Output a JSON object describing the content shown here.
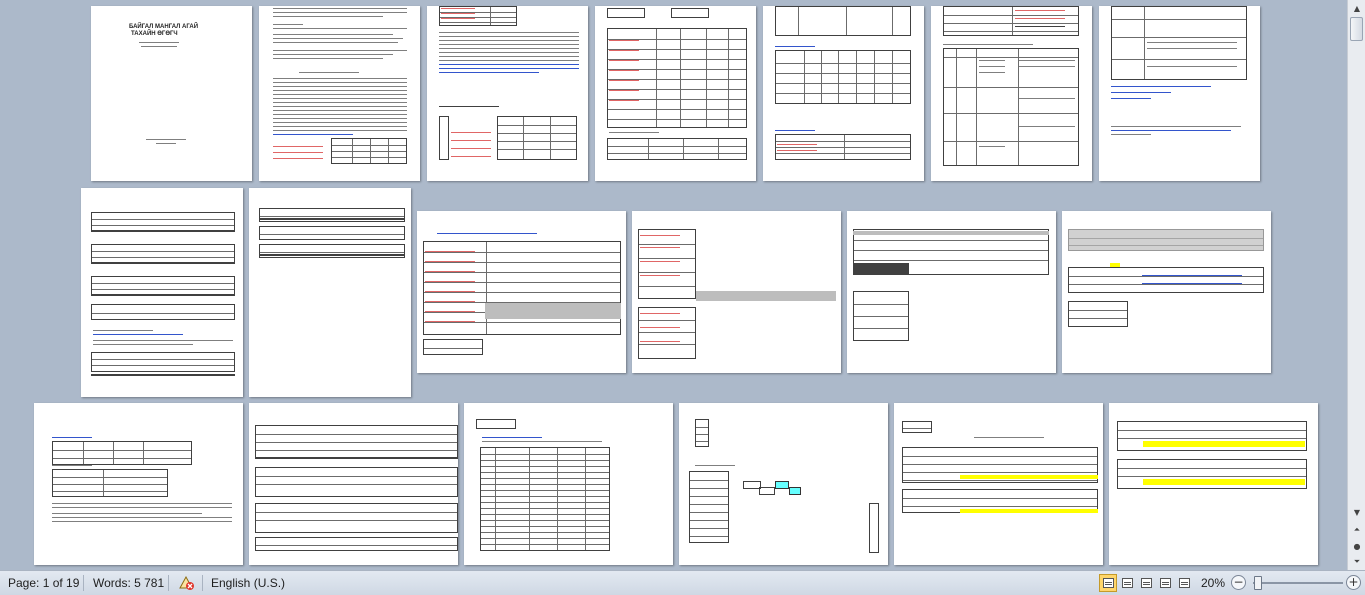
{
  "document": {
    "cover_title_line1": "БАЙГАЛ МАНГАЛ АГАЙ",
    "cover_title_line2": "ТАХАЙН ӨГӨГЧ"
  },
  "statusbar": {
    "page_label": "Page: 1 of 19",
    "words_label": "Words: 5 781",
    "language": "English (U.S.)",
    "zoom_level": "20%",
    "zoom_fraction": 0.2
  },
  "icons": {
    "proofing": "proofing-icon",
    "view_print_layout": "print-layout-icon",
    "view_full_screen": "full-screen-reading-icon",
    "view_web_layout": "web-layout-icon",
    "view_outline": "outline-icon",
    "view_draft": "draft-icon",
    "scroll_up": "scroll-up-arrow-icon",
    "scroll_down": "scroll-down-arrow-icon",
    "prev_page": "previous-page-icon",
    "select_browse": "select-browse-object-icon",
    "next_page": "next-page-icon"
  },
  "colors": {
    "workspace": "#acb9ca",
    "page": "#ffffff",
    "highlight_yellow": "#ffff00",
    "cyan_cell": "#66ffff",
    "active_view": "#ffd66b"
  }
}
